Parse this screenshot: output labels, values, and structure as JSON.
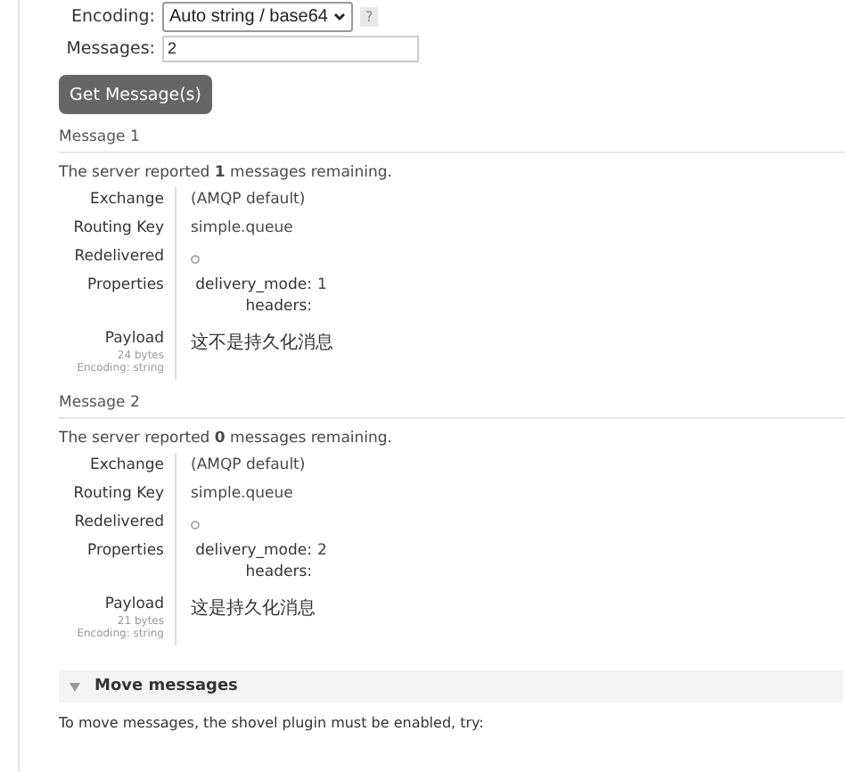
{
  "form": {
    "encoding": {
      "label": "Encoding:",
      "value": "Auto string / base64",
      "help": "?"
    },
    "messages": {
      "label": "Messages:",
      "value": "2"
    },
    "button": "Get Message(s)"
  },
  "messages": [
    {
      "title": "Message 1",
      "report": "The server reported **1** messages remaining.",
      "fields": {
        "exchange": {
          "label": "Exchange",
          "value": "(AMQP default)"
        },
        "routing_key": {
          "label": "Routing Key",
          "value": "simple.queue"
        },
        "redelivered": {
          "label": "Redelivered",
          "value": false
        },
        "properties": {
          "label": "Properties",
          "items": [
            {
              "key": "delivery_mode:",
              "value": "1"
            },
            {
              "key": "headers:",
              "value": ""
            }
          ]
        },
        "payload": {
          "label": "Payload",
          "size": "24 bytes",
          "encoding": "Encoding: string",
          "value": "这不是持久化消息"
        }
      }
    },
    {
      "title": "Message 2",
      "report": "The server reported **0** messages remaining.",
      "fields": {
        "exchange": {
          "label": "Exchange",
          "value": "(AMQP default)"
        },
        "routing_key": {
          "label": "Routing Key",
          "value": "simple.queue"
        },
        "redelivered": {
          "label": "Redelivered",
          "value": false
        },
        "properties": {
          "label": "Properties",
          "items": [
            {
              "key": "delivery_mode:",
              "value": "2"
            },
            {
              "key": "headers:",
              "value": ""
            }
          ]
        },
        "payload": {
          "label": "Payload",
          "size": "21 bytes",
          "encoding": "Encoding: string",
          "value": "这是持久化消息"
        }
      }
    }
  ],
  "move": {
    "title": "Move messages",
    "expanded": true,
    "text": "To move messages, the shovel plugin must be enabled, try:"
  }
}
